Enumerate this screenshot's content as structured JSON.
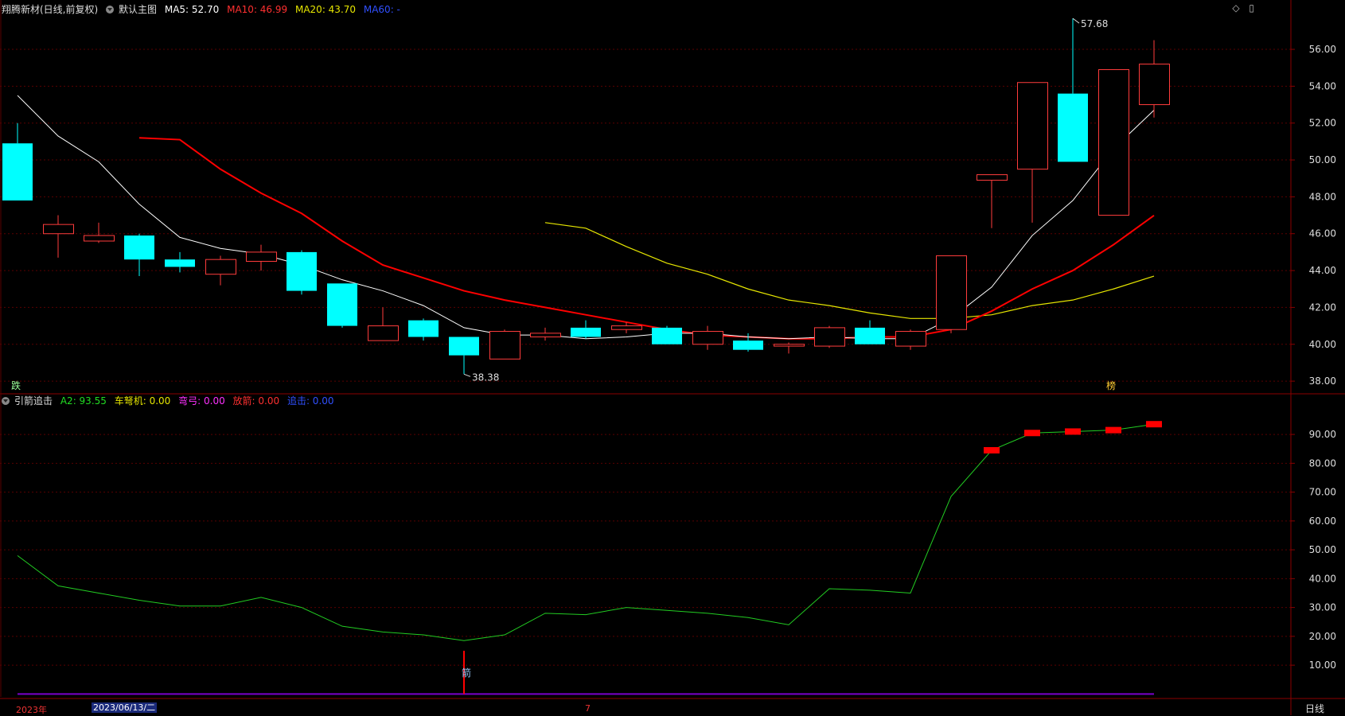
{
  "header": {
    "stock": "翔腾新材(日线,前复权)",
    "template": "默认主图",
    "ma5": "MA5: 52.70",
    "ma10": "MA10: 46.99",
    "ma20": "MA20: 43.70",
    "ma60": "MA60: -"
  },
  "sub_header": {
    "indicator": "引箭追击",
    "a2": "A2: 93.55",
    "che": "车弩机: 0.00",
    "qigong": "弯弓: 0.00",
    "fangjian": "放箭: 0.00",
    "zhuiji": "追击: 0.00"
  },
  "toolbar_icons": [
    "diamond-icon",
    "window-icon"
  ],
  "bottom": {
    "year": "2023年",
    "date": "2023/06/13/二",
    "month": "7",
    "period": "日线"
  },
  "marks": {
    "die": "跌",
    "bang": "榜",
    "jian": "箭"
  },
  "colors": {
    "up": "#ff3c3c",
    "down": "#00ffff",
    "ma5": "#ffffff",
    "ma10": "#ff0000",
    "ma20": "#e6e600",
    "a2": "#22cc22",
    "grid": "#5a0000"
  },
  "chart_data": [
    {
      "type": "candlestick",
      "yticks": [
        "38.00",
        "40.00",
        "42.00",
        "44.00",
        "46.00",
        "48.00",
        "50.00",
        "52.00",
        "54.00",
        "56.00"
      ],
      "ylim": [
        37.4,
        57.9
      ],
      "high_label": "57.68",
      "low_label": "38.38",
      "candles": [
        {
          "o": 50.9,
          "c": 47.8,
          "h": 52.0,
          "l": 47.8
        },
        {
          "o": 46.0,
          "c": 46.5,
          "h": 47.0,
          "l": 44.7
        },
        {
          "o": 45.6,
          "c": 45.9,
          "h": 46.6,
          "l": 45.5
        },
        {
          "o": 45.9,
          "c": 44.6,
          "h": 46.0,
          "l": 43.7
        },
        {
          "o": 44.6,
          "c": 44.2,
          "h": 45.0,
          "l": 43.9
        },
        {
          "o": 43.8,
          "c": 44.6,
          "h": 44.8,
          "l": 43.2
        },
        {
          "o": 44.5,
          "c": 45.0,
          "h": 45.4,
          "l": 44.0
        },
        {
          "o": 45.0,
          "c": 42.9,
          "h": 45.1,
          "l": 42.7
        },
        {
          "o": 43.3,
          "c": 41.0,
          "h": 43.3,
          "l": 40.9
        },
        {
          "o": 40.2,
          "c": 41.0,
          "h": 42.0,
          "l": 40.2
        },
        {
          "o": 41.3,
          "c": 40.4,
          "h": 41.4,
          "l": 40.2
        },
        {
          "o": 40.4,
          "c": 39.4,
          "h": 40.4,
          "l": 38.38
        },
        {
          "o": 39.2,
          "c": 40.7,
          "h": 40.8,
          "l": 39.2
        },
        {
          "o": 40.4,
          "c": 40.6,
          "h": 40.9,
          "l": 40.2
        },
        {
          "o": 40.9,
          "c": 40.4,
          "h": 41.3,
          "l": 40.3
        },
        {
          "o": 40.8,
          "c": 41.0,
          "h": 41.2,
          "l": 40.6
        },
        {
          "o": 40.9,
          "c": 40.0,
          "h": 41.0,
          "l": 40.0
        },
        {
          "o": 40.0,
          "c": 40.7,
          "h": 41.0,
          "l": 39.7
        },
        {
          "o": 40.2,
          "c": 39.7,
          "h": 40.6,
          "l": 39.6
        },
        {
          "o": 39.9,
          "c": 40.0,
          "h": 40.1,
          "l": 39.5
        },
        {
          "o": 39.9,
          "c": 40.9,
          "h": 41.0,
          "l": 39.8
        },
        {
          "o": 40.9,
          "c": 40.0,
          "h": 41.3,
          "l": 40.0
        },
        {
          "o": 39.9,
          "c": 40.7,
          "h": 40.8,
          "l": 39.7
        },
        {
          "o": 40.8,
          "c": 44.8,
          "h": 44.8,
          "l": 40.6
        },
        {
          "o": 48.9,
          "c": 49.2,
          "h": 49.2,
          "l": 46.3
        },
        {
          "o": 49.5,
          "c": 54.2,
          "h": 54.2,
          "l": 46.6
        },
        {
          "o": 53.6,
          "c": 49.9,
          "h": 57.68,
          "l": 49.9
        },
        {
          "o": 47.0,
          "c": 54.9,
          "h": 54.9,
          "l": 47.0
        },
        {
          "o": 53.0,
          "c": 55.2,
          "h": 56.5,
          "l": 52.3
        }
      ],
      "ma5": [
        53.5,
        51.3,
        49.9,
        47.6,
        45.8,
        45.2,
        44.9,
        44.3,
        43.5,
        42.9,
        42.1,
        40.9,
        40.5,
        40.5,
        40.3,
        40.4,
        40.6,
        40.6,
        40.4,
        40.3,
        40.4,
        40.3,
        40.3,
        41.4,
        43.1,
        45.9,
        47.8,
        50.6,
        52.7
      ],
      "ma10": [
        null,
        null,
        null,
        51.2,
        51.1,
        49.5,
        48.2,
        47.1,
        45.6,
        44.3,
        43.6,
        42.9,
        42.4,
        42.0,
        41.6,
        41.2,
        40.8,
        40.5,
        40.4,
        40.3,
        40.3,
        40.4,
        40.4,
        40.8,
        41.8,
        43.0,
        44.0,
        45.4,
        46.99
      ],
      "ma20": [
        null,
        null,
        null,
        null,
        null,
        null,
        null,
        null,
        null,
        null,
        null,
        null,
        null,
        46.6,
        46.3,
        45.3,
        44.4,
        43.8,
        43.0,
        42.4,
        42.1,
        41.7,
        41.4,
        41.4,
        41.6,
        42.1,
        42.4,
        43.0,
        43.7
      ]
    },
    {
      "type": "line",
      "yticks": [
        "10.00",
        "20.00",
        "30.00",
        "40.00",
        "50.00",
        "60.00",
        "70.00",
        "80.00",
        "90.00"
      ],
      "ylim": [
        -1,
        100.5
      ],
      "series": [
        {
          "name": "A2",
          "values": [
            48,
            37.5,
            35,
            32.5,
            30.5,
            30.5,
            33.5,
            30,
            23.5,
            21.5,
            20.5,
            18.5,
            20.5,
            28,
            27.5,
            30,
            29,
            28,
            26.5,
            24,
            36.5,
            36,
            35,
            68.5,
            84.5,
            90.5,
            91,
            91.5,
            93.55
          ]
        }
      ],
      "red_bars_at": [
        24,
        25,
        26,
        27,
        28
      ],
      "jian_at": 11
    }
  ]
}
